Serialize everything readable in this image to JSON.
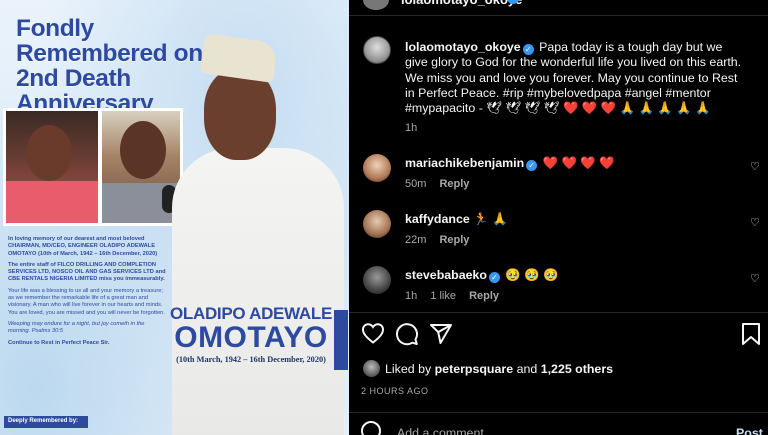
{
  "poster": {
    "headline": "Fondly Remembered on the 2nd Death Anniversary",
    "intro": "In loving memory of our dearest and most beloved CHAIRMAN, MD/CEO, ENGINEER OLADIPO ADEWALE OMOTAYO (10th of March, 1942 – 16th December, 2020)",
    "staff": "The entire staff of FILCO DRILLING AND COMPLETION SERVICES LTD, NOSCO OIL AND GAS SERVICES LTD and CBE RENTALS NIGERIA LIMITED miss you immeasurably.",
    "blessing": "Your life was a blessing to us all and your memory a treasure; as we remember the remarkable life of a great man and visionary. A man who will live forever in our hearts and minds. You are loved, you are missed and you will never be forgotten.",
    "psalm": "Weeping may endure for a night, but joy cometh in the morning. Psalms 30:5",
    "rest": "Continue to Rest in Perfect Peace Sir.",
    "remembered_by": "Deeply Remembered by:",
    "first_names": "OLADIPO ADEWALE",
    "surname": "OMOTAYO",
    "dates": "(10th March, 1942 – 16th December, 2020)"
  },
  "header": {
    "username": "lolaomotayo_okoye"
  },
  "caption": {
    "username": "lolaomotayo_okoye",
    "text": "Papa today is a tough day but we give glory to God for the wonderful life you lived on this earth. We miss you and love you forever. May you continue to Rest in Perfect Peace. #rip #mybelovedpapa #angel #mentor #mypapacito - 🕊 🕊 🕊 🕊 ❤️ ❤️ ❤️ 🙏 🙏 🙏 🙏 🙏",
    "age": "1h"
  },
  "comments": [
    {
      "username": "mariachikebenjamin",
      "text": "❤️ ❤️ ❤️ ❤️",
      "age": "50m",
      "likes": "",
      "reply": "Reply"
    },
    {
      "username": "kaffydance",
      "text": "🏃 🙏",
      "age": "22m",
      "likes": "",
      "reply": "Reply"
    },
    {
      "username": "stevebabaeko",
      "text": "🥹 🥹 🥹",
      "age": "1h",
      "likes": "1 like",
      "reply": "Reply"
    }
  ],
  "likes": {
    "prefix": "Liked by",
    "user": "peterpsquare",
    "conj": "and",
    "others": "1,225 others"
  },
  "timestamp": "2 HOURS AGO",
  "add_comment": {
    "placeholder": "Add a comment...",
    "post_label": "Post"
  },
  "icons": {
    "like": "heart-icon",
    "comment": "comment-bubble-icon",
    "share": "paper-plane-icon",
    "save": "bookmark-icon",
    "emoji": "smiley-icon",
    "verified": "verified-badge-icon"
  },
  "colors": {
    "background": "#000000",
    "text": "#f5f5f5",
    "muted": "#a8a8a8",
    "verified": "#3897f0",
    "poster_blue": "#2d4aa0"
  }
}
